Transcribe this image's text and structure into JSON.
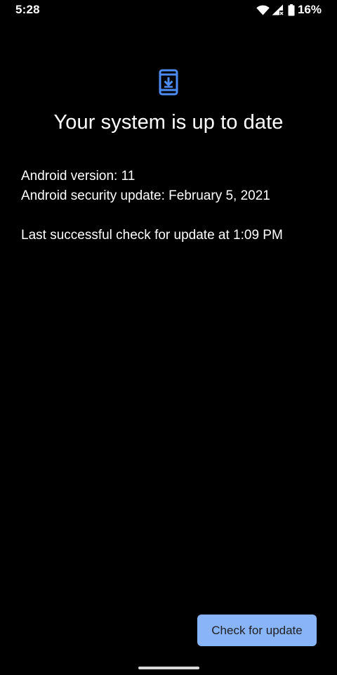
{
  "status_bar": {
    "time": "5:28",
    "battery_percent": "16%",
    "wifi": "wifi-icon",
    "signal": "signal-no-data-icon",
    "battery": "battery-icon"
  },
  "icon": {
    "name": "system-update-icon",
    "color": "#4d8cf5"
  },
  "title": "Your system is up to date",
  "info": {
    "android_version": "Android version: 11",
    "security_update": "Android security update: February 5, 2021",
    "last_check": "Last successful check for update at 1:09 PM"
  },
  "check_button": {
    "label": "Check for update",
    "color": "#8ab4f8"
  }
}
